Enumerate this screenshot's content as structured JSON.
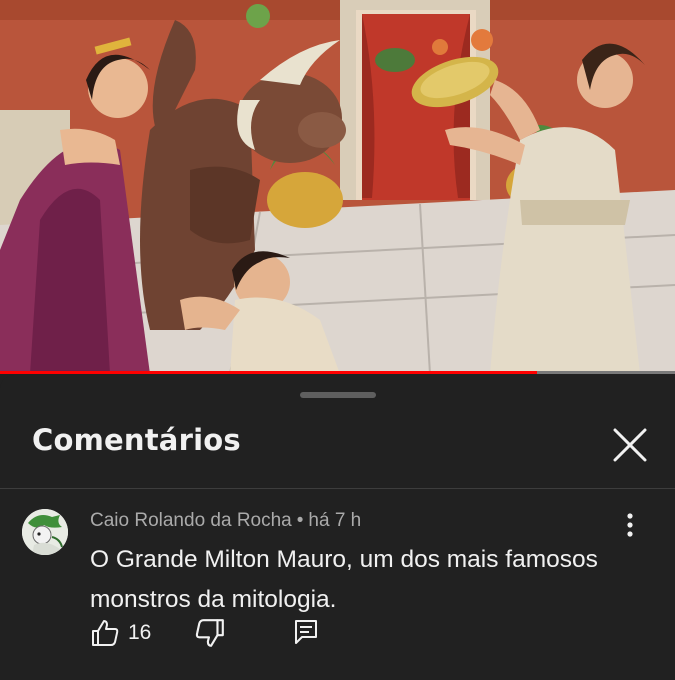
{
  "video": {
    "progress": 0.795,
    "progress_color": "#ff0000"
  },
  "comments_panel": {
    "title": "Comentários",
    "close_icon": "close-icon"
  },
  "comment": {
    "author": "Caio Rolando da Rocha",
    "separator": "•",
    "time": "há 7 h",
    "text": "O Grande Milton Mauro, um dos mais famosos monstros da mitologia.",
    "likes": "16",
    "icons": {
      "like": "thumbs-up-icon",
      "dislike": "thumbs-down-icon",
      "reply": "reply-icon",
      "menu": "more-vert-icon"
    }
  },
  "colors": {
    "background": "#212121",
    "text": "#f1f1f1",
    "secondary_text": "#aaaaaa"
  }
}
